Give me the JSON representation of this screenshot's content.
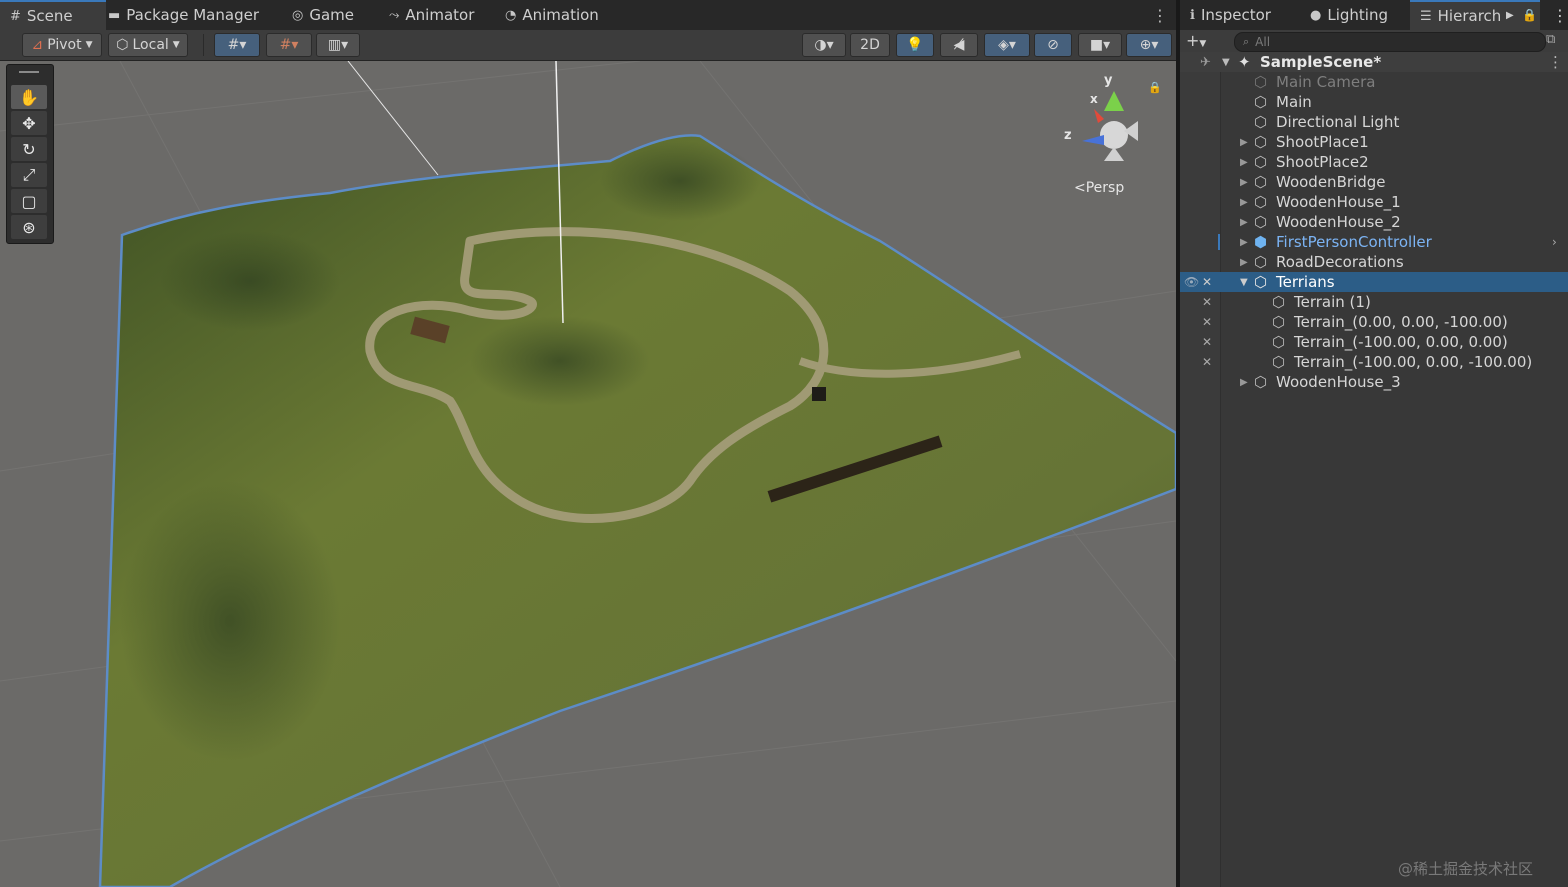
{
  "scene_tabs": [
    {
      "label": "Scene",
      "icon": "grid-icon"
    },
    {
      "label": "Package Manager",
      "icon": "package-icon"
    },
    {
      "label": "Game",
      "icon": "gamepad-icon"
    },
    {
      "label": "Animator",
      "icon": "animator-icon"
    },
    {
      "label": "Animation",
      "icon": "clock-icon"
    }
  ],
  "toolbar": {
    "pivot": "Pivot",
    "local": "Local",
    "mode_2d": "2D"
  },
  "viewport": {
    "projection_label": "<Persp",
    "gizmo_axes": {
      "y": "y",
      "x": "x",
      "z": "z"
    }
  },
  "right_tabs": [
    {
      "label": "Inspector",
      "icon": "info-icon"
    },
    {
      "label": "Lighting",
      "icon": "bulb-icon"
    },
    {
      "label": "Hierarch",
      "icon": "list-icon"
    }
  ],
  "search": {
    "placeholder": "All"
  },
  "hierarchy": {
    "scene_name": "SampleScene*",
    "items": [
      {
        "label": "Main Camera",
        "depth": 1,
        "expand": "none",
        "dim": true
      },
      {
        "label": "Main",
        "depth": 1,
        "expand": "none"
      },
      {
        "label": "Directional Light",
        "depth": 1,
        "expand": "none"
      },
      {
        "label": "ShootPlace1",
        "depth": 1,
        "expand": "collapsed"
      },
      {
        "label": "ShootPlace2",
        "depth": 1,
        "expand": "collapsed"
      },
      {
        "label": "WoodenBridge",
        "depth": 1,
        "expand": "collapsed"
      },
      {
        "label": "WoodenHouse_1",
        "depth": 1,
        "expand": "collapsed"
      },
      {
        "label": "WoodenHouse_2",
        "depth": 1,
        "expand": "collapsed"
      },
      {
        "label": "FirstPersonController",
        "depth": 1,
        "expand": "collapsed",
        "prefab": true
      },
      {
        "label": "RoadDecorations",
        "depth": 1,
        "expand": "collapsed"
      },
      {
        "label": "Terrians",
        "depth": 1,
        "expand": "expanded",
        "selected": true
      },
      {
        "label": "Terrain (1)",
        "depth": 2,
        "expand": "none"
      },
      {
        "label": "Terrain_(0.00, 0.00, -100.00)",
        "depth": 2,
        "expand": "none"
      },
      {
        "label": "Terrain_(-100.00, 0.00, 0.00)",
        "depth": 2,
        "expand": "none"
      },
      {
        "label": "Terrain_(-100.00, 0.00, -100.00)",
        "depth": 2,
        "expand": "none"
      },
      {
        "label": "WoodenHouse_3",
        "depth": 1,
        "expand": "collapsed"
      }
    ]
  },
  "colors": {
    "selected_row": "#2c5d87",
    "prefab_text": "#7cb4f4",
    "accent": "#3a79bb"
  },
  "watermark": "@稀土掘金技术社区"
}
